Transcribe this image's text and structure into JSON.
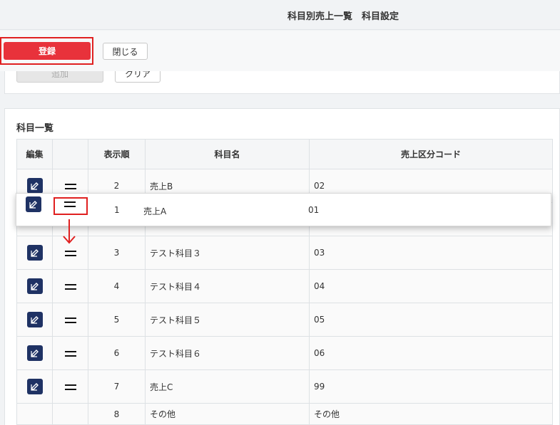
{
  "header": {
    "title": "科目別売上一覧　科目設定"
  },
  "toolbar": {
    "register_label": "登録",
    "close_label": "閉じる"
  },
  "form": {
    "add_label": "追加",
    "clear_label": "クリア"
  },
  "list": {
    "title": "科目一覧",
    "columns": [
      "編集",
      "",
      "表示順",
      "科目名",
      "売上区分コード"
    ],
    "rows": [
      {
        "order": "2",
        "name": "売上B",
        "code": "02"
      },
      {
        "order": "3",
        "name": "テスト科目３",
        "code": "03"
      },
      {
        "order": "4",
        "name": "テスト科目４",
        "code": "04"
      },
      {
        "order": "5",
        "name": "テスト科目５",
        "code": "05"
      },
      {
        "order": "6",
        "name": "テスト科目６",
        "code": "06"
      },
      {
        "order": "7",
        "name": "売上C",
        "code": "99"
      },
      {
        "order": "8",
        "name": "その他",
        "code": "その他"
      }
    ],
    "dragging_row": {
      "order": "1",
      "name": "売上A",
      "code": "01"
    }
  },
  "colors": {
    "accent_red": "#e8323b",
    "highlight": "#e02020",
    "edit_icon_bg": "#1f3264"
  },
  "icons": {
    "edit": "edit-icon",
    "drag": "drag-handle-icon",
    "arrow": "arrow-down-icon"
  }
}
